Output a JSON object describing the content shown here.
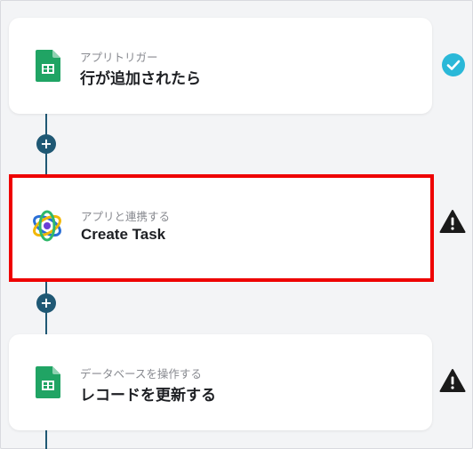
{
  "steps": [
    {
      "subtitle": "アプリトリガー",
      "title": "行が追加されたら",
      "app_icon": "google-sheets-icon",
      "status_icon": "check-circle-icon",
      "status_color": "#2ab8d8"
    },
    {
      "subtitle": "アプリと連携する",
      "title": "Create Task",
      "app_icon": "meistertask-logo-icon",
      "status_icon": "warning-icon",
      "status_color": "#1a1a1a"
    },
    {
      "subtitle": "データベースを操作する",
      "title": "レコードを更新する",
      "app_icon": "google-sheets-icon",
      "status_icon": "warning-icon",
      "status_color": "#1a1a1a"
    }
  ],
  "colors": {
    "connector": "#1f5874",
    "highlight_border": "#ee0000",
    "sheets_green": "#20a464"
  }
}
